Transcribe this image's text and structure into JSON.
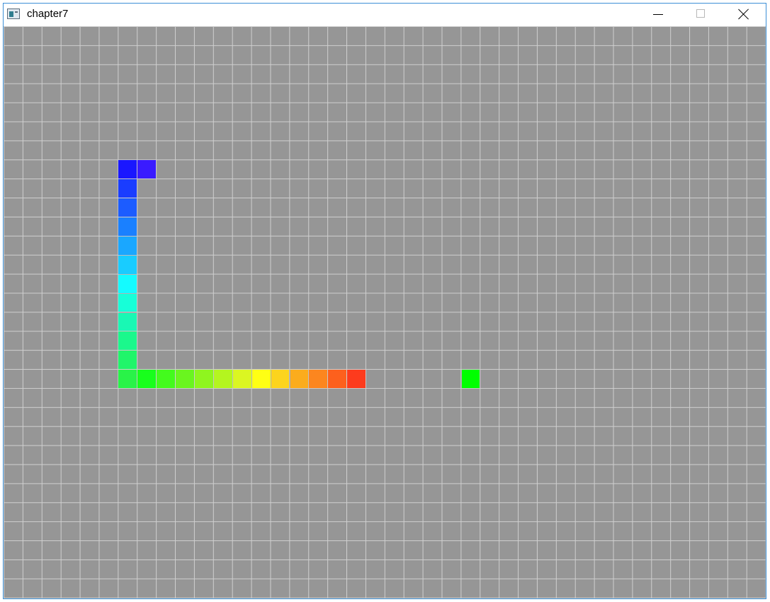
{
  "window": {
    "title": "chapter7"
  },
  "icons": {
    "app": "app-window-icon",
    "minimize": "minimize-icon",
    "maximize": "maximize-icon",
    "close": "close-icon"
  },
  "board": {
    "background_color": "#969696",
    "grid_line_color": "#cfcfcf",
    "columns": 40,
    "rows": 30
  },
  "snake": {
    "segments": [
      {
        "col": 7,
        "row": 7,
        "color": "#3a1bff"
      },
      {
        "col": 6,
        "row": 7,
        "color": "#1a17ff"
      },
      {
        "col": 6,
        "row": 8,
        "color": "#1a3dff"
      },
      {
        "col": 6,
        "row": 9,
        "color": "#1c5cff"
      },
      {
        "col": 6,
        "row": 10,
        "color": "#1a80ff"
      },
      {
        "col": 6,
        "row": 11,
        "color": "#1aa7ff"
      },
      {
        "col": 6,
        "row": 12,
        "color": "#19ccff"
      },
      {
        "col": 6,
        "row": 13,
        "color": "#14fbff"
      },
      {
        "col": 6,
        "row": 14,
        "color": "#17ffd8"
      },
      {
        "col": 6,
        "row": 15,
        "color": "#19f8b4"
      },
      {
        "col": 6,
        "row": 16,
        "color": "#1bf88c"
      },
      {
        "col": 6,
        "row": 17,
        "color": "#20f56a"
      },
      {
        "col": 6,
        "row": 18,
        "color": "#29f348"
      },
      {
        "col": 7,
        "row": 18,
        "color": "#18ff1c"
      },
      {
        "col": 8,
        "row": 18,
        "color": "#43fb1d"
      },
      {
        "col": 9,
        "row": 18,
        "color": "#6af51f"
      },
      {
        "col": 10,
        "row": 18,
        "color": "#8ff51f"
      },
      {
        "col": 11,
        "row": 18,
        "color": "#b4f51f"
      },
      {
        "col": 12,
        "row": 18,
        "color": "#dbf622"
      },
      {
        "col": 13,
        "row": 18,
        "color": "#ffff14"
      },
      {
        "col": 14,
        "row": 18,
        "color": "#fcd41d"
      },
      {
        "col": 15,
        "row": 18,
        "color": "#fbac1d"
      },
      {
        "col": 16,
        "row": 18,
        "color": "#fc861f"
      },
      {
        "col": 17,
        "row": 18,
        "color": "#fd601d"
      },
      {
        "col": 18,
        "row": 18,
        "color": "#fd3b1d"
      }
    ]
  },
  "food": {
    "col": 24,
    "row": 18,
    "color": "#00ff00"
  }
}
